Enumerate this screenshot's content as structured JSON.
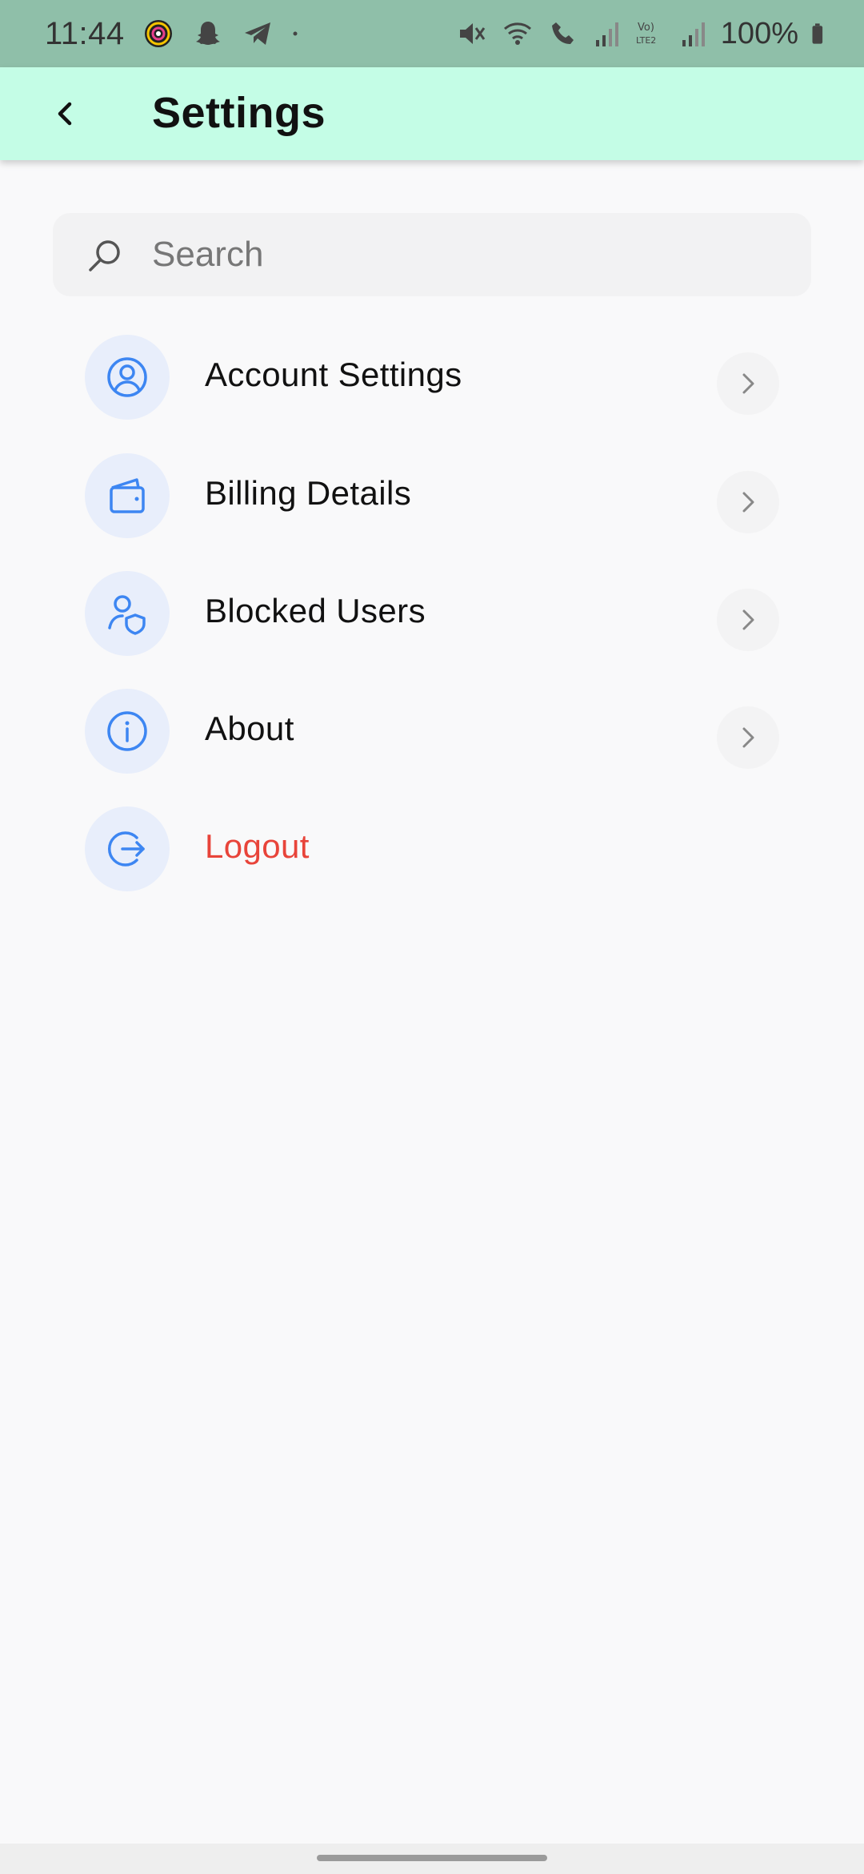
{
  "status_bar": {
    "time": "11:44",
    "battery_text": "100%",
    "left_icons": [
      "threads-icon",
      "snapchat-icon",
      "telegram-icon",
      "dot-icon"
    ],
    "right_icons": [
      "mute-icon",
      "wifi-icon",
      "wifi-call-icon",
      "signal-icon",
      "volte-icon",
      "signal-icon",
      "battery-icon"
    ]
  },
  "app_bar": {
    "title": "Settings",
    "back_icon": "chevron-left-icon"
  },
  "search": {
    "placeholder": "Search",
    "value": ""
  },
  "menu": {
    "items": [
      {
        "label": "Account Settings",
        "icon": "user-circle-icon",
        "has_chevron": true
      },
      {
        "label": "Billing Details",
        "icon": "wallet-icon",
        "has_chevron": true
      },
      {
        "label": "Blocked Users",
        "icon": "user-shield-icon",
        "has_chevron": true
      },
      {
        "label": "About",
        "icon": "info-icon",
        "has_chevron": true
      },
      {
        "label": "Logout",
        "icon": "logout-icon",
        "has_chevron": false
      }
    ]
  },
  "colors": {
    "status_bar_bg": "#8fbfa9",
    "app_bar_bg": "#c4fde6",
    "icon_accent": "#3d86f2",
    "icon_circle_bg": "#e8eefb",
    "logout_text": "#e8443a"
  }
}
